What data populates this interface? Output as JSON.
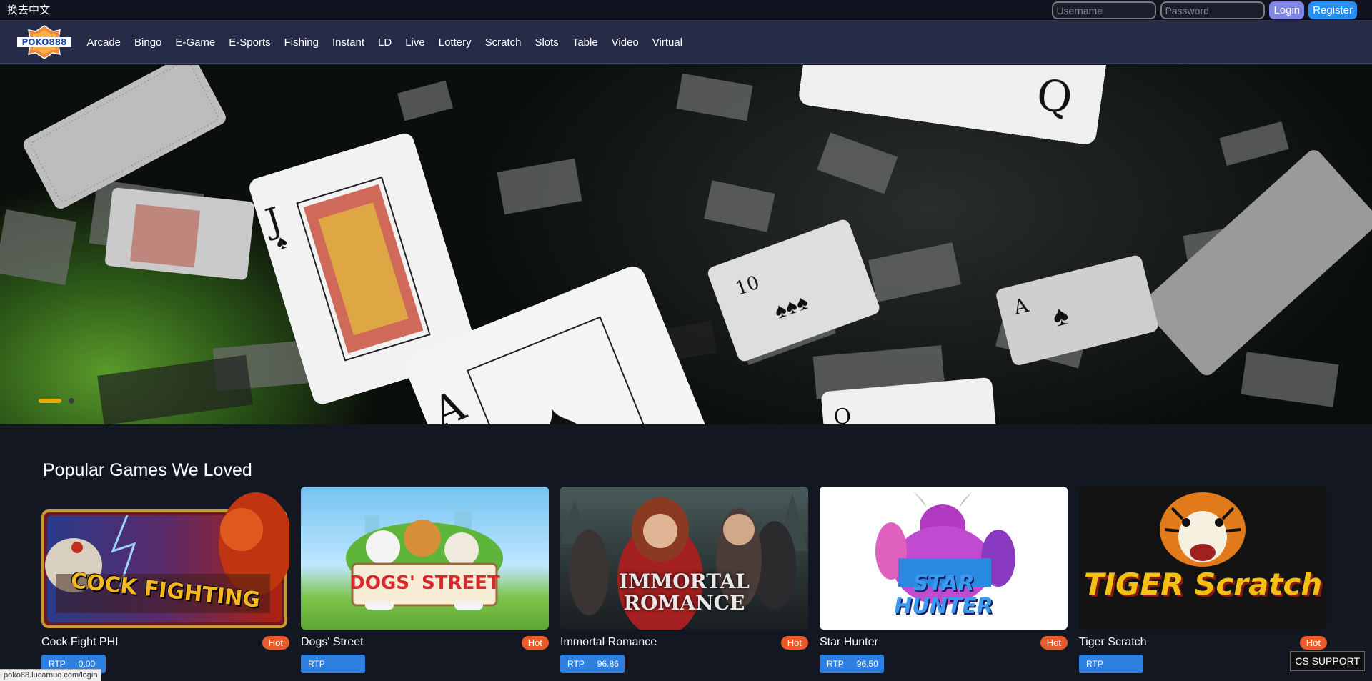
{
  "topbar": {
    "lang_label": "换去中文",
    "username_placeholder": "Username",
    "password_placeholder": "Password",
    "login_label": "Login",
    "register_label": "Register"
  },
  "brand": {
    "logo_text": "POKO888"
  },
  "nav": {
    "items": [
      "Arcade",
      "Bingo",
      "E-Game",
      "E-Sports",
      "Fishing",
      "Instant",
      "LD",
      "Live",
      "Lottery",
      "Scratch",
      "Slots",
      "Table",
      "Video",
      "Virtual"
    ]
  },
  "hero": {
    "active_slide": 1,
    "slide_count": 2
  },
  "popular": {
    "title": "Popular Games We Loved",
    "games": [
      {
        "name": "Cock Fight PHI",
        "badge": "Hot",
        "rtp_label": "RTP",
        "rtp_value": "0.00",
        "thumb_text": "COCK FIGHTING"
      },
      {
        "name": "Dogs' Street",
        "badge": "Hot",
        "rtp_label": "RTP",
        "rtp_value": "",
        "thumb_text": "DOGS' STREET"
      },
      {
        "name": "Immortal Romance",
        "badge": "Hot",
        "rtp_label": "RTP",
        "rtp_value": "96.86",
        "thumb_text": "IMMORTAL ROMANCE"
      },
      {
        "name": "Star Hunter",
        "badge": "Hot",
        "rtp_label": "RTP",
        "rtp_value": "96.50",
        "thumb_text": "STAR HUNTER"
      },
      {
        "name": "Tiger Scratch",
        "badge": "Hot",
        "rtp_label": "RTP",
        "rtp_value": "",
        "thumb_text": "TIGER Scratch"
      }
    ]
  },
  "status_url": "poko88.lucarnuo.com/login",
  "cs_support_label": "CS SUPPORT",
  "colors": {
    "nav_bg": "#262b48",
    "page_bg": "#131722",
    "accent_register": "#2a8ef0",
    "accent_login": "#7f86e3",
    "hot": "#ea5b2b",
    "rtp": "#2d7fe0",
    "slider_active": "#e6a90a"
  }
}
